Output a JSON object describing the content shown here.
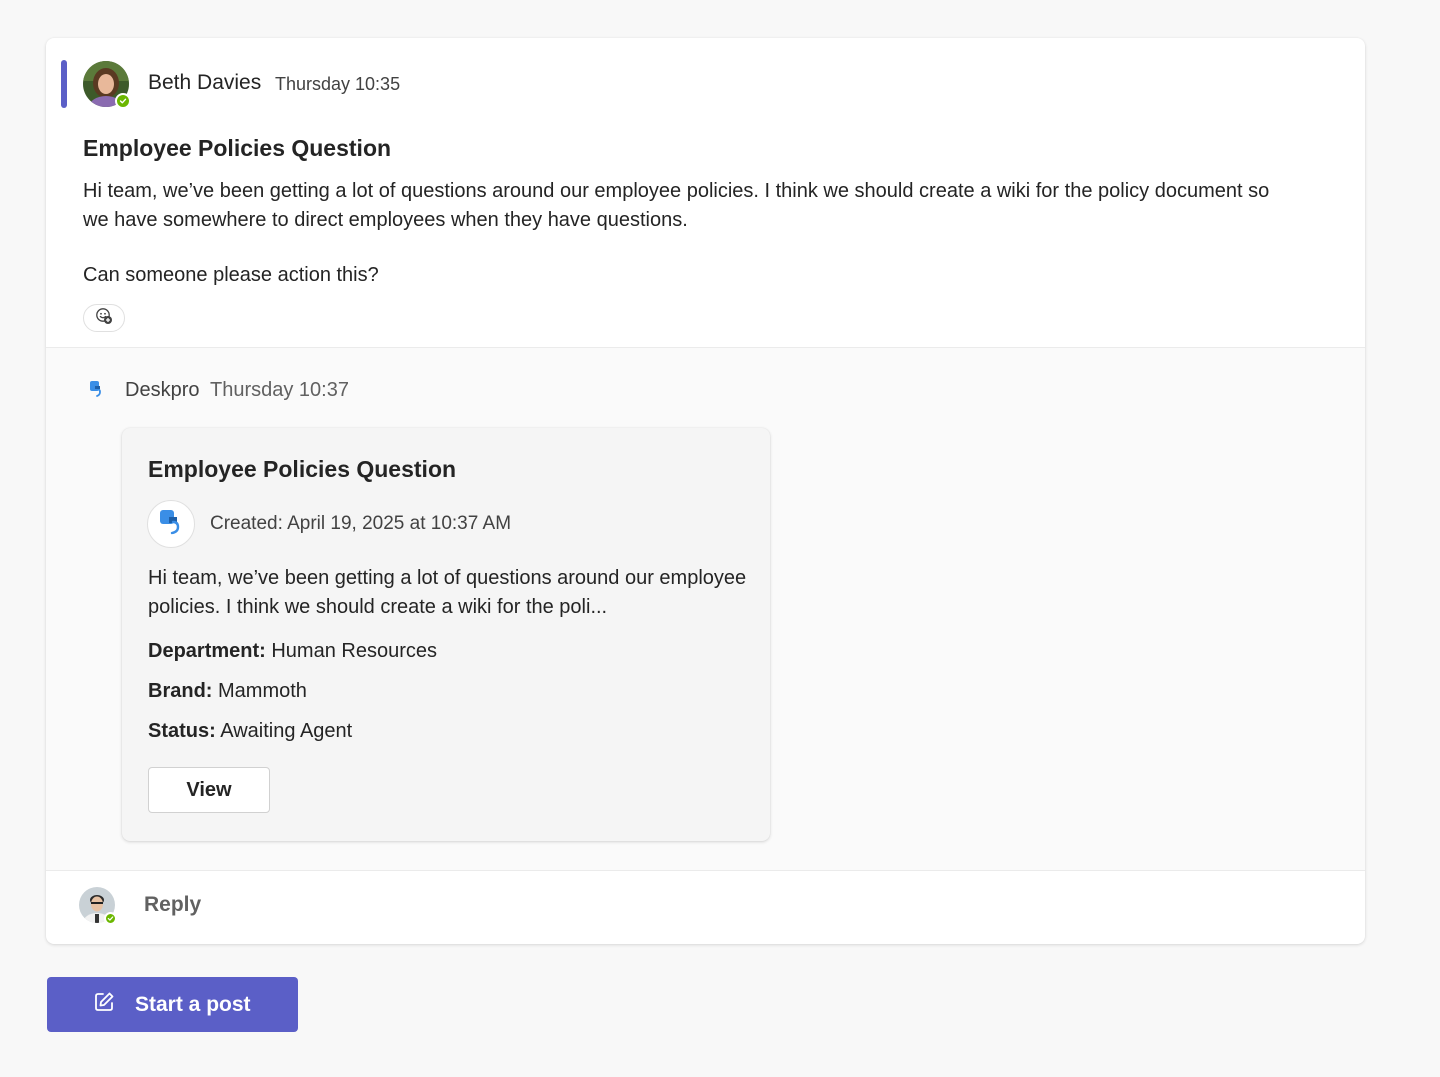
{
  "post": {
    "author": "Beth Davies",
    "time": "Thursday 10:35",
    "title": "Employee Policies Question",
    "body": "Hi team, we’ve been getting a lot of questions around our employee policies. I think we should create a wiki for the policy document so we have somewhere to direct employees when they have questions.",
    "body2": "Can someone please action this?",
    "accent_color": "#5b5fc7",
    "presence_color": "#6bb700"
  },
  "bot_reply": {
    "bot_name": "Deskpro",
    "time": "Thursday 10:37",
    "icon": "deskpro-logo-icon",
    "card": {
      "title": "Employee Policies Question",
      "created": "Created: April 19, 2025 at 10:37 AM",
      "description": "Hi team, we’ve been getting a lot of questions around our employee policies. I think we should create a wiki for the poli...",
      "fields": [
        {
          "label": "Department:",
          "value": "Human Resources"
        },
        {
          "label": "Brand:",
          "value": "Mammoth"
        },
        {
          "label": "Status:",
          "value": "Awaiting Agent"
        }
      ],
      "view_label": "View"
    }
  },
  "reply": {
    "label": "Reply"
  },
  "start_post": {
    "label": "Start a post",
    "icon": "compose-icon"
  }
}
